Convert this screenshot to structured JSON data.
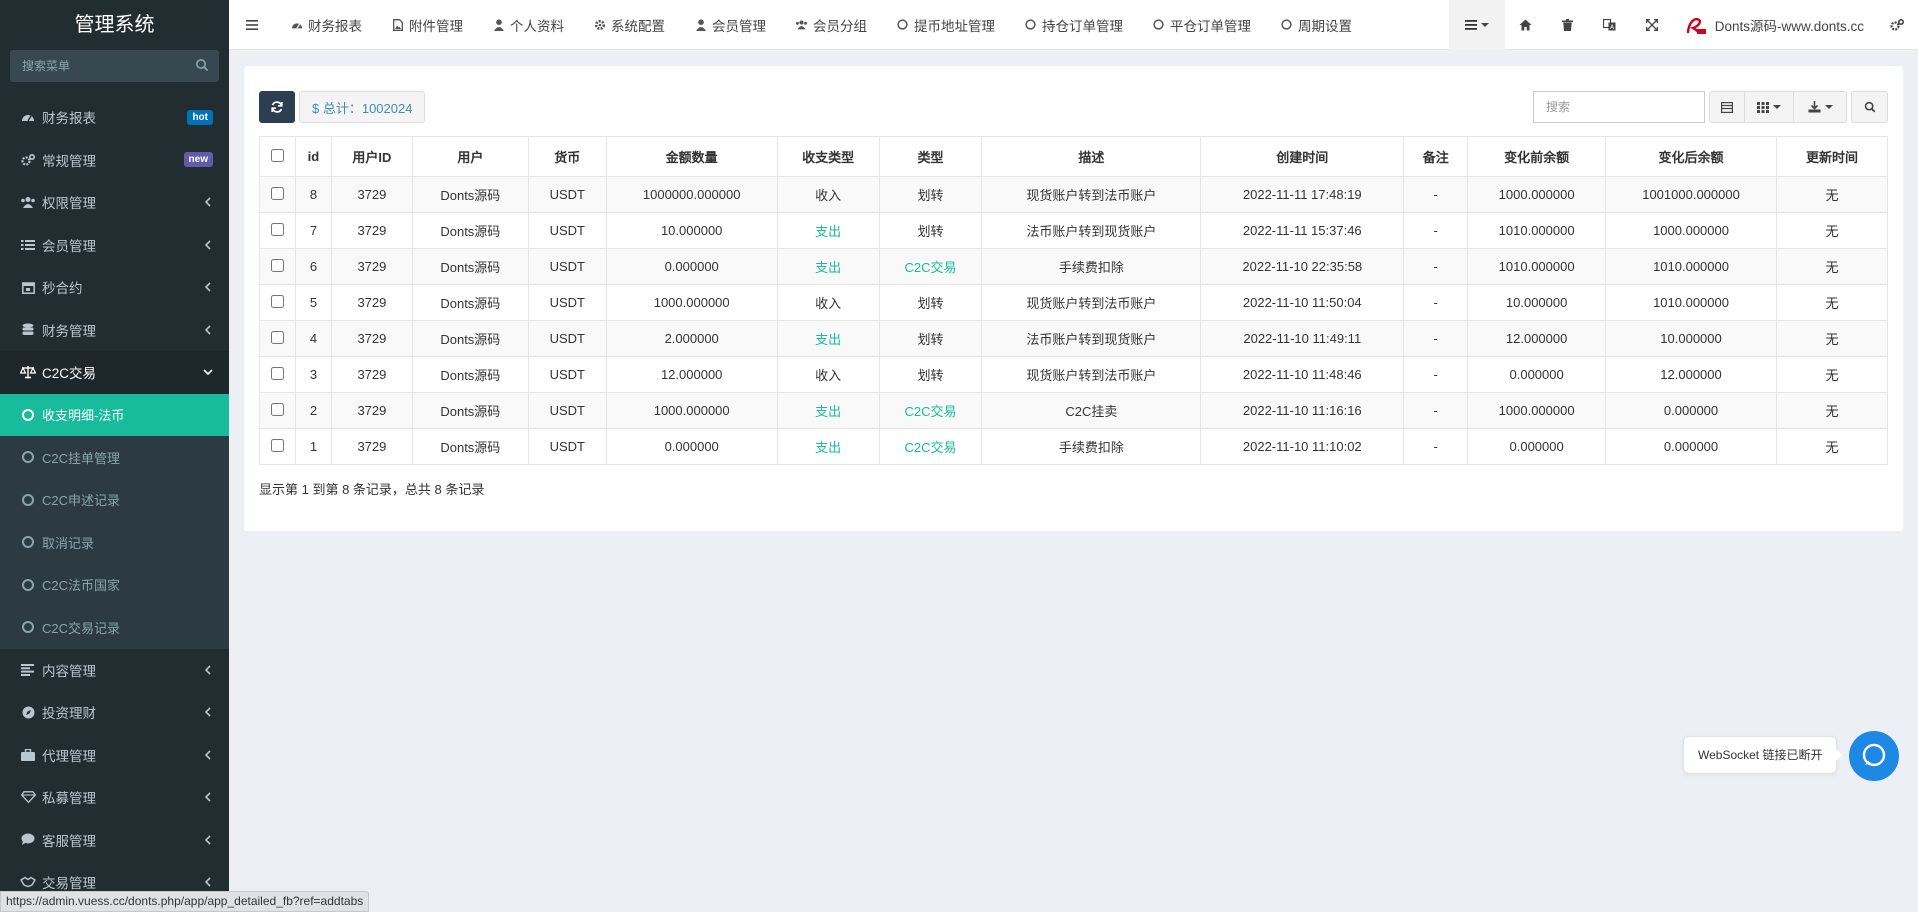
{
  "app": {
    "title": "管理系统"
  },
  "sidebar": {
    "search_placeholder": "搜索菜单",
    "items": [
      {
        "label": "财务报表",
        "icon": "dashboard-icon",
        "badge": "hot"
      },
      {
        "label": "常规管理",
        "icon": "cogs-icon",
        "badge": "new"
      },
      {
        "label": "权限管理",
        "icon": "group-icon"
      },
      {
        "label": "会员管理",
        "icon": "list-icon"
      },
      {
        "label": "秒合约",
        "icon": "calendar-icon"
      },
      {
        "label": "财务管理",
        "icon": "database-icon"
      },
      {
        "label": "C2C交易",
        "icon": "balance-scale-icon"
      }
    ],
    "submenu": [
      {
        "label": "收支明细-法币"
      },
      {
        "label": "C2C挂单管理"
      },
      {
        "label": "C2C申述记录"
      },
      {
        "label": "取消记录"
      },
      {
        "label": "C2C法币国家"
      },
      {
        "label": "C2C交易记录"
      }
    ],
    "items_after": [
      {
        "label": "内容管理",
        "icon": "align-left-icon"
      },
      {
        "label": "投资理财",
        "icon": "compass-icon"
      },
      {
        "label": "代理管理",
        "icon": "briefcase-icon"
      },
      {
        "label": "私募管理",
        "icon": "diamond-icon"
      },
      {
        "label": "客服管理",
        "icon": "comment-icon"
      },
      {
        "label": "交易管理",
        "icon": "handshake-icon"
      }
    ]
  },
  "topnav": {
    "tabs": [
      {
        "label": "财务报表",
        "icon": "dashboard-icon"
      },
      {
        "label": "附件管理",
        "icon": "file-image-icon"
      },
      {
        "label": "个人资料",
        "icon": "user-icon"
      },
      {
        "label": "系统配置",
        "icon": "gear-icon"
      },
      {
        "label": "会员管理",
        "icon": "user-icon"
      },
      {
        "label": "会员分组",
        "icon": "users-icon"
      },
      {
        "label": "提币地址管理",
        "icon": "circle-icon"
      },
      {
        "label": "持仓订单管理",
        "icon": "circle-icon"
      },
      {
        "label": "平仓订单管理",
        "icon": "circle-icon"
      },
      {
        "label": "周期设置",
        "icon": "circle-icon"
      }
    ],
    "user_name": "Donts源码-www.donts.cc"
  },
  "toolbar": {
    "total_label": "$ 总计：1002024",
    "search_placeholder": "搜索"
  },
  "table": {
    "columns": [
      "id",
      "用户ID",
      "用户",
      "货币",
      "金额数量",
      "收支类型",
      "类型",
      "描述",
      "创建时间",
      "备注",
      "变化前余额",
      "变化后余额",
      "更新时间"
    ],
    "rows": [
      {
        "id": "8",
        "uid": "3729",
        "user": "Donts源码",
        "currency": "USDT",
        "amount": "1000000.000000",
        "io": "收入",
        "io_green": false,
        "type": "划转",
        "type_green": false,
        "desc": "现货账户转到法币账户",
        "created": "2022-11-11 17:48:19",
        "note": "-",
        "before": "1000.000000",
        "after": "1001000.000000",
        "updated": "无"
      },
      {
        "id": "7",
        "uid": "3729",
        "user": "Donts源码",
        "currency": "USDT",
        "amount": "10.000000",
        "io": "支出",
        "io_green": true,
        "type": "划转",
        "type_green": false,
        "desc": "法币账户转到现货账户",
        "created": "2022-11-11 15:37:46",
        "note": "-",
        "before": "1010.000000",
        "after": "1000.000000",
        "updated": "无"
      },
      {
        "id": "6",
        "uid": "3729",
        "user": "Donts源码",
        "currency": "USDT",
        "amount": "0.000000",
        "io": "支出",
        "io_green": true,
        "type": "C2C交易",
        "type_green": true,
        "desc": "手续费扣除",
        "created": "2022-11-10 22:35:58",
        "note": "-",
        "before": "1010.000000",
        "after": "1010.000000",
        "updated": "无"
      },
      {
        "id": "5",
        "uid": "3729",
        "user": "Donts源码",
        "currency": "USDT",
        "amount": "1000.000000",
        "io": "收入",
        "io_green": false,
        "type": "划转",
        "type_green": false,
        "desc": "现货账户转到法币账户",
        "created": "2022-11-10 11:50:04",
        "note": "-",
        "before": "10.000000",
        "after": "1010.000000",
        "updated": "无"
      },
      {
        "id": "4",
        "uid": "3729",
        "user": "Donts源码",
        "currency": "USDT",
        "amount": "2.000000",
        "io": "支出",
        "io_green": true,
        "type": "划转",
        "type_green": false,
        "desc": "法币账户转到现货账户",
        "created": "2022-11-10 11:49:11",
        "note": "-",
        "before": "12.000000",
        "after": "10.000000",
        "updated": "无"
      },
      {
        "id": "3",
        "uid": "3729",
        "user": "Donts源码",
        "currency": "USDT",
        "amount": "12.000000",
        "io": "收入",
        "io_green": false,
        "type": "划转",
        "type_green": false,
        "desc": "现货账户转到法币账户",
        "created": "2022-11-10 11:48:46",
        "note": "-",
        "before": "0.000000",
        "after": "12.000000",
        "updated": "无"
      },
      {
        "id": "2",
        "uid": "3729",
        "user": "Donts源码",
        "currency": "USDT",
        "amount": "1000.000000",
        "io": "支出",
        "io_green": true,
        "type": "C2C交易",
        "type_green": true,
        "desc": "C2C挂卖",
        "created": "2022-11-10 11:16:16",
        "note": "-",
        "before": "1000.000000",
        "after": "0.000000",
        "updated": "无"
      },
      {
        "id": "1",
        "uid": "3729",
        "user": "Donts源码",
        "currency": "USDT",
        "amount": "0.000000",
        "io": "支出",
        "io_green": true,
        "type": "C2C交易",
        "type_green": true,
        "desc": "手续费扣除",
        "created": "2022-11-10 11:10:02",
        "note": "-",
        "before": "0.000000",
        "after": "0.000000",
        "updated": "无"
      }
    ],
    "pagination": "显示第 1 到第 8 条记录，总共 8 条记录"
  },
  "status_bar": {
    "url": "https://admin.vuess.cc/donts.php/app/app_detailed_fb?ref=addtabs"
  },
  "websocket": {
    "tip": "WebSocket 链接已断开"
  },
  "colors": {
    "sidebar_bg": "#222d32",
    "accent": "#18bc9c",
    "link": "#3c8dbc",
    "ws_button": "#1e88e5"
  }
}
